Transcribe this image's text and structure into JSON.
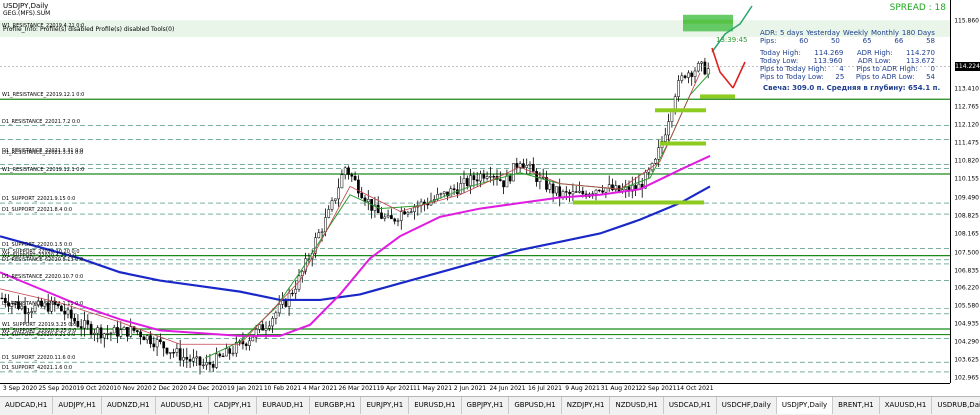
{
  "header": {
    "title": "USDJPY,Daily",
    "info_line_1": "GEG.(MFS).SUM",
    "info_line_2": "Profile_Info: Profile(s) disabled Profile(s) disabled Tools(0)"
  },
  "spread": "SPREAD : 18",
  "adr": {
    "columns": [
      "ADR:",
      "5 days",
      "Yesterday",
      "Weekly",
      "Monthly",
      "180 Days"
    ],
    "pips": [
      "Pips:",
      "60",
      "50",
      "65",
      "66",
      "58"
    ],
    "today_high": "Today High:",
    "today_high_value": "114.269",
    "adr_high": "ADR High:",
    "adr_high_value": "114.270",
    "today_low": "Today Low:",
    "today_low_value": "113.960",
    "adr_low": "ADR Low:",
    "adr_low_value": "113.672",
    "pips_to_high": "Pips to Today High:",
    "pips_to_high_value": "4",
    "pips_to_adr_high": "Pips to ADR High:",
    "pips_to_adr_high_value": "0",
    "pips_to_low": "Pips to Today Low:",
    "pips_to_low_value": "25",
    "pips_to_adr_low": "Pips to ADR Low:",
    "pips_to_adr_low_value": "54"
  },
  "candle_timer": "13:39:45",
  "candle_stats": "Свеча: 309.0 п. Средняя в глубину: 654.1 п.",
  "current_price": "114.224",
  "price_axis": [
    "115.860",
    "114.224",
    "113.410",
    "112.765",
    "112.120",
    "111.475",
    "110.820",
    "110.155",
    "109.490",
    "108.825",
    "108.165",
    "107.500",
    "106.835",
    "106.220",
    "105.580",
    "104.935",
    "104.290",
    "103.625",
    "102.965"
  ],
  "time_axis": [
    "3 Sep 2020",
    "25 Sep 2020",
    "19 Oct 2020",
    "10 Nov 2020",
    "2 Dec 2020",
    "24 Dec 2020",
    "19 Jan 2021",
    "10 Feb 2021",
    "4 Mar 2021",
    "26 Mar 2021",
    "19 Apr 2021",
    "11 May 2021",
    "2 Jun 2021",
    "24 Jun 2021",
    "16 Jul 2021",
    "9 Aug 2021",
    "31 Aug 2021",
    "22 Sep 2021",
    "14 Oct 2021"
  ],
  "levels": [
    "W1_RESISTANCE_22019.4.21 0:0",
    "W1_RESISTANCE_22019.12.1 0:0",
    "D1_RESISTANCE_22021.7.2 0:0",
    "D1_RESISTANCE_22021.3.31 0:0",
    "D1_RESISTANCE_22021.3.31 0:0",
    "W1_RESISTANCE_22019.12.1 0:0",
    "D1_SUPPORT_22021.9.15 0:0",
    "D1_SUPPORT_22021.8.4 0:0",
    "D1_SUPPORT_22020.1.5 0:0",
    "W1_SUPPORT_22020.10.20 0:0",
    "W1_SUPPORT_22020.4.21 0:0",
    "D1_RESISTANCE_62020.8.13 0:0",
    "D1_RESISTANCE_22020.10.7 0:0",
    "D1_RESISTANCE_22021.1.11 0:0",
    "W1_SUPPORT_22019.3.25 0:0",
    "W1_SUPPORT_22020.8.25 0:0",
    "D1_SUPPORT_62020.9.21 0:0",
    "D1_SUPPORT_22020.11.6 0:0",
    "D1_SUPPORT_42021.1.6 0:0"
  ],
  "tabs": [
    "AUDCAD,H1",
    "AUDJPY,H1",
    "AUDNZD,H1",
    "AUDUSD,H1",
    "CADJPY,H1",
    "EURAUD,H1",
    "EURGBP,H1",
    "EURJPY,H1",
    "EURUSD,H1",
    "GBPJPY,H1",
    "GBPUSD,H1",
    "NZDJPY,H1",
    "NZDUSD,H1",
    "USDCAD,H1",
    "USDCHF,Daily",
    "USDJPY,Daily",
    "BRENT,H1",
    "XAUUSD,H1",
    "USDRUB,Daily"
  ],
  "active_tab": "USDJPY,Daily",
  "colors": {
    "bull": "#000000",
    "bear": "#000000",
    "ma_blue": "#1a28c8",
    "ma_magenta": "#e01ce0",
    "ma_green": "#2c9c2c",
    "ma_dark_red": "#c0404a",
    "green_level": "#1b8a1b",
    "lime_zone": "#8ecb20"
  }
}
